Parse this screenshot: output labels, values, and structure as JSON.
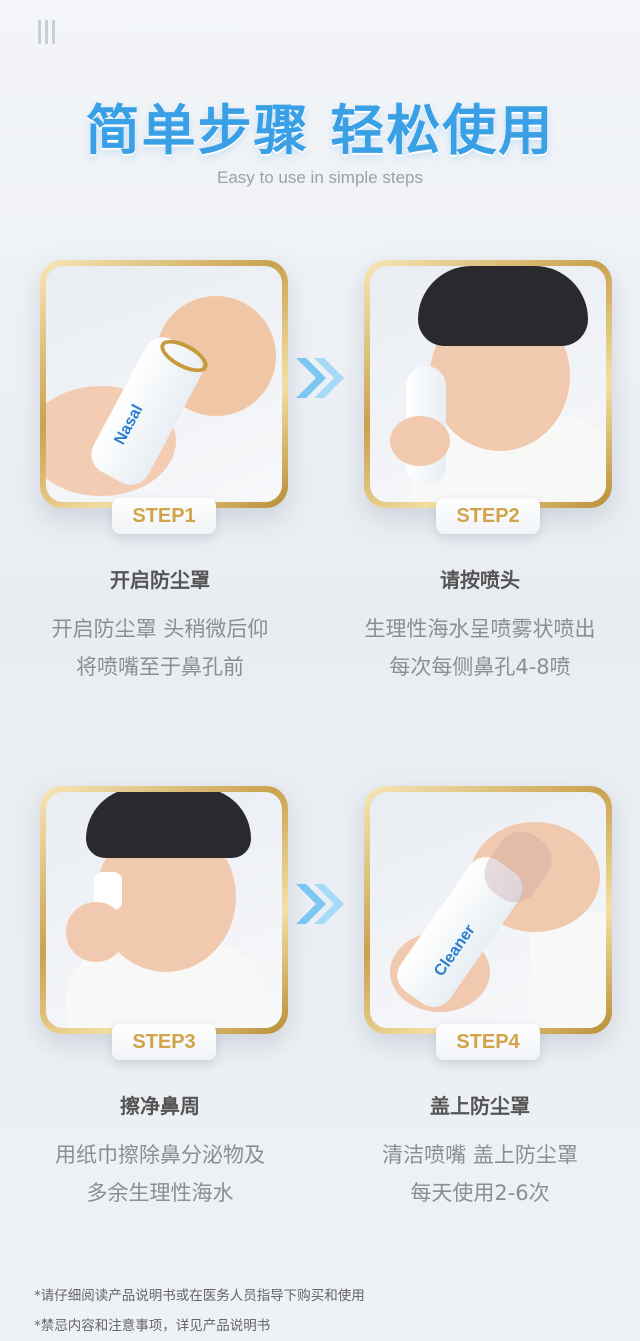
{
  "header": {
    "title": "简单步骤 轻松使用",
    "subtitle": "Easy to use in simple steps"
  },
  "steps": [
    {
      "badge": "STEP1",
      "title": "开启防尘罩",
      "desc1": "开启防尘罩  头稍微后仰",
      "desc2": "将喷嘴至于鼻孔前"
    },
    {
      "badge": "STEP2",
      "title": "请按喷头",
      "desc1": "生理性海水呈喷雾状喷出",
      "desc2": "每次每侧鼻孔4-8喷"
    },
    {
      "badge": "STEP3",
      "title": "擦净鼻周",
      "desc1": "用纸巾擦除鼻分泌物及",
      "desc2": "多余生理性海水"
    },
    {
      "badge": "STEP4",
      "title": "盖上防尘罩",
      "desc1": "清洁喷嘴  盖上防尘罩",
      "desc2": "每天使用2-6次"
    }
  ],
  "product": {
    "brand_line1": "Nasal",
    "brand_line2": "Cleaner"
  },
  "footnotes": [
    "*请仔细阅读产品说明书或在医务人员指导下购买和使用",
    "*禁忌内容和注意事项，详见产品说明书"
  ],
  "colors": {
    "title": "#3aa0e6",
    "gold": "#d2a44a",
    "arrow": "#7cc6f2"
  }
}
